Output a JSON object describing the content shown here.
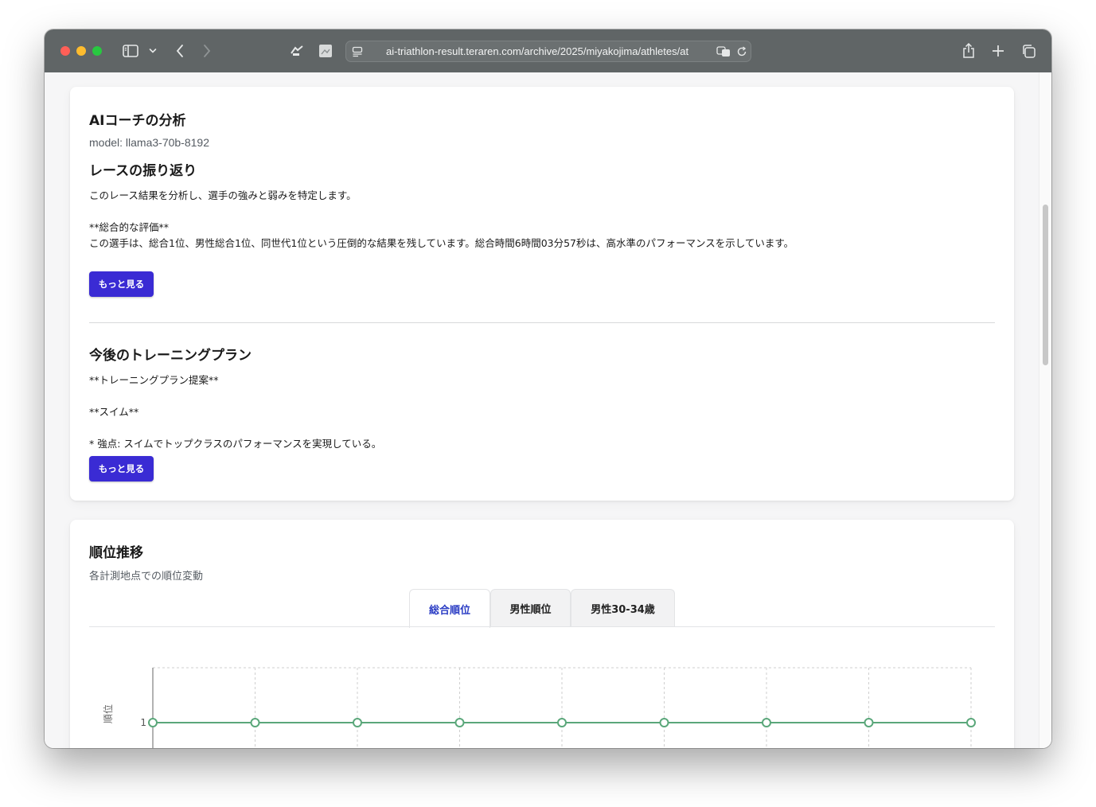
{
  "browser": {
    "url": "ai-triathlon-result.teraren.com/archive/2025/miyakojima/athletes/at"
  },
  "analysis": {
    "title": "AIコーチの分析",
    "model": "model: llama3-70b-8192",
    "review": {
      "heading": "レースの振り返り",
      "line1": "このレース結果を分析し、選手の強みと弱みを特定します。",
      "line2": "**総合的な評価**",
      "line3": "この選手は、総合1位、男性総合1位、同世代1位という圧倒的な結果を残しています。総合時間6時間03分57秒は、高水準のパフォーマンスを示しています。",
      "more_label": "もっと見る"
    },
    "training": {
      "heading": "今後のトレーニングプラン",
      "line1": "**トレーニングプラン提案**",
      "line2": "**スイム**",
      "line3": "* 強点: スイムでトップクラスのパフォーマンスを実現している。",
      "more_label": "もっと見る"
    }
  },
  "ranking": {
    "title": "順位推移",
    "subtitle": "各計測地点での順位変動",
    "tabs": [
      {
        "label": "総合順位",
        "active": true
      },
      {
        "label": "男性順位",
        "active": false
      },
      {
        "label": "男性30-34歳",
        "active": false
      }
    ]
  },
  "chart_data": {
    "type": "line",
    "ylabel": "順位",
    "y_ticks": [
      "1"
    ],
    "series": [
      {
        "values": [
          1,
          1,
          1,
          1,
          1,
          1,
          1,
          1,
          1
        ],
        "color": "#5aa77a"
      }
    ],
    "grid": true
  }
}
